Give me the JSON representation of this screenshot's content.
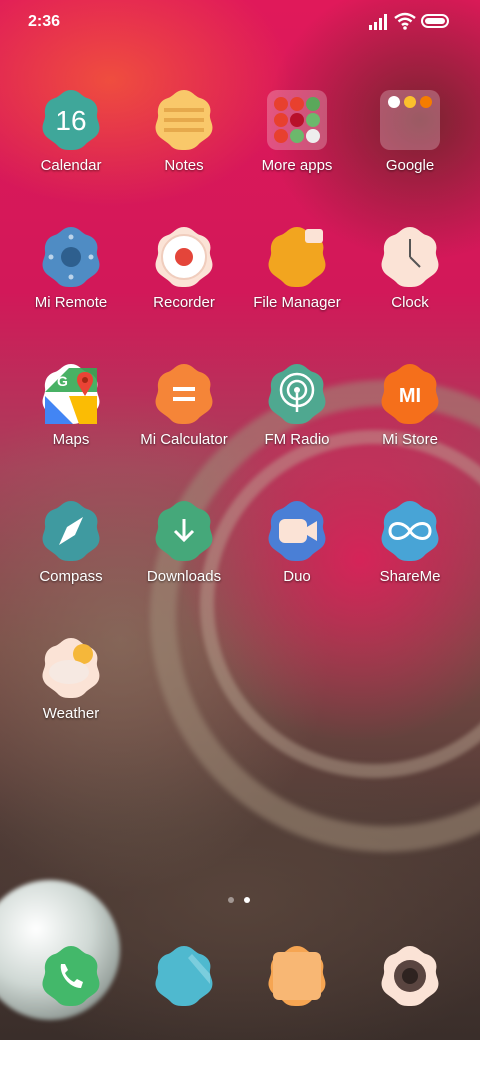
{
  "status_bar": {
    "time": "2:36",
    "battery_level": 1.0
  },
  "apps": [
    {
      "label": "Calendar",
      "icon": "calendar-icon",
      "badge_text": "16"
    },
    {
      "label": "Notes",
      "icon": "notes-icon"
    },
    {
      "label": "More apps",
      "icon": "folder-icon"
    },
    {
      "label": "Google",
      "icon": "google-folder-icon"
    },
    {
      "label": "Mi Remote",
      "icon": "remote-icon"
    },
    {
      "label": "Recorder",
      "icon": "record-icon"
    },
    {
      "label": "File Manager",
      "icon": "folder-file-icon"
    },
    {
      "label": "Clock",
      "icon": "clock-icon"
    },
    {
      "label": "Maps",
      "icon": "maps-icon"
    },
    {
      "label": "Mi Calculator",
      "icon": "calculator-icon"
    },
    {
      "label": "FM Radio",
      "icon": "radio-icon"
    },
    {
      "label": "Mi Store",
      "icon": "mi-store-icon",
      "badge_text": "MI"
    },
    {
      "label": "Compass",
      "icon": "compass-icon"
    },
    {
      "label": "Downloads",
      "icon": "download-icon"
    },
    {
      "label": "Duo",
      "icon": "video-camera-icon"
    },
    {
      "label": "ShareMe",
      "icon": "infinity-icon"
    },
    {
      "label": "Weather",
      "icon": "weather-icon"
    }
  ],
  "dock": [
    {
      "icon": "phone-icon"
    },
    {
      "icon": "messages-icon"
    },
    {
      "icon": "gallery-icon"
    },
    {
      "icon": "camera-icon"
    }
  ],
  "page_indicator": {
    "count": 2,
    "active": 2
  },
  "colors": {
    "teal": "#3fa79a",
    "notes_yellow": "#f9c86a",
    "remote_blue": "#4f8cc4",
    "record_red": "#e4453a",
    "file_orange": "#f2a51f",
    "clock_cream": "#fbe3d6",
    "calc_orange": "#f58538",
    "radio_green": "#4fa890",
    "mi_orange": "#f56f1b",
    "compass_teal": "#3f9aa0",
    "download_green": "#45a87a",
    "duo_blue": "#4a7fd6",
    "share_blue": "#48a4d6",
    "phone_green": "#43b86a",
    "msg_cyan": "#4fb9cf",
    "gallery_orange": "#f6a552",
    "camera_cream": "#fbe3d6"
  }
}
